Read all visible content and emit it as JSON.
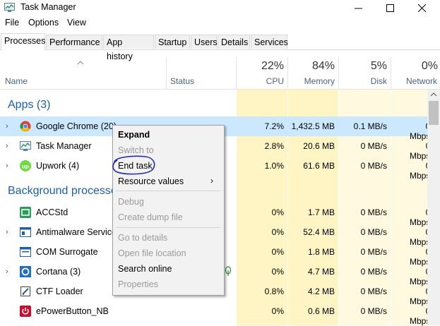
{
  "window": {
    "title": "Task Manager"
  },
  "menu": [
    "File",
    "Options",
    "View"
  ],
  "tabs": [
    "Processes",
    "Performance",
    "App history",
    "Startup",
    "Users",
    "Details",
    "Services"
  ],
  "columns": {
    "name": "Name",
    "status": "Status",
    "cpu": {
      "pct": "22%",
      "label": "CPU"
    },
    "memory": {
      "pct": "84%",
      "label": "Memory"
    },
    "disk": {
      "pct": "5%",
      "label": "Disk"
    },
    "network": {
      "pct": "0%",
      "label": "Network"
    }
  },
  "sections": {
    "apps": "Apps (3)",
    "background": "Background processes"
  },
  "rows": [
    {
      "name": "Google Chrome (20)",
      "cpu": "7.2%",
      "memory": "1,432.5 MB",
      "disk": "0.1 MB/s",
      "network": "0 Mbps"
    },
    {
      "name": "Task Manager",
      "cpu": "2.8%",
      "memory": "20.6 MB",
      "disk": "0 MB/s",
      "network": "0 Mbps"
    },
    {
      "name": "Upwork (4)",
      "cpu": "1.0%",
      "memory": "61.6 MB",
      "disk": "0 MB/s",
      "network": "0 Mbps"
    },
    {
      "name": "ACCStd",
      "cpu": "0%",
      "memory": "1.7 MB",
      "disk": "0 MB/s",
      "network": "0 Mbps"
    },
    {
      "name": "Antimalware Service Executable",
      "cpu": "0%",
      "memory": "52.4 MB",
      "disk": "0 MB/s",
      "network": "0 Mbps"
    },
    {
      "name": "COM Surrogate",
      "cpu": "0%",
      "memory": "1.8 MB",
      "disk": "0 MB/s",
      "network": "0 Mbps"
    },
    {
      "name": "Cortana (3)",
      "cpu": "0%",
      "memory": "4.7 MB",
      "disk": "0 MB/s",
      "network": "0 Mbps"
    },
    {
      "name": "CTF Loader",
      "cpu": "0.8%",
      "memory": "4.2 MB",
      "disk": "0 MB/s",
      "network": "0 Mbps"
    },
    {
      "name": "ePowerButton_NB",
      "cpu": "0%",
      "memory": "0.6 MB",
      "disk": "0 MB/s",
      "network": "0 Mbps"
    }
  ],
  "context_menu": {
    "expand": "Expand",
    "switch_to": "Switch to",
    "end_task": "End task",
    "resource_values": "Resource values",
    "debug": "Debug",
    "create_dump": "Create dump file",
    "go_to_details": "Go to details",
    "open_file_location": "Open file location",
    "search_online": "Search online",
    "properties": "Properties"
  },
  "colors": {
    "cpu_shade": "#fff4c4",
    "selected_row": "#cce8ff",
    "section_text": "#1a5fa8",
    "annotation": "#1f2bb8"
  }
}
